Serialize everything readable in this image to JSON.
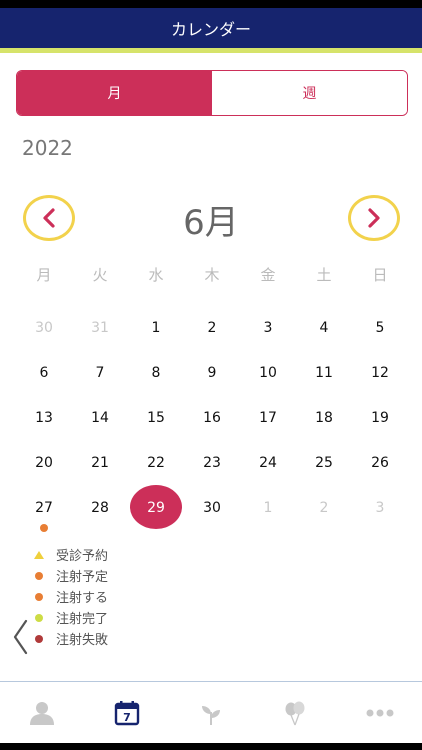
{
  "header": {
    "title": "カレンダー"
  },
  "view_toggle": {
    "month_label": "月",
    "week_label": "週"
  },
  "year": "2022",
  "month_label": "6月",
  "weekdays": [
    "月",
    "火",
    "水",
    "木",
    "金",
    "土",
    "日"
  ],
  "weeks": [
    [
      {
        "d": "30",
        "m": true
      },
      {
        "d": "31",
        "m": true
      },
      {
        "d": "1"
      },
      {
        "d": "2"
      },
      {
        "d": "3"
      },
      {
        "d": "4"
      },
      {
        "d": "5"
      }
    ],
    [
      {
        "d": "6"
      },
      {
        "d": "7"
      },
      {
        "d": "8"
      },
      {
        "d": "9"
      },
      {
        "d": "10"
      },
      {
        "d": "11"
      },
      {
        "d": "12"
      }
    ],
    [
      {
        "d": "13"
      },
      {
        "d": "14"
      },
      {
        "d": "15"
      },
      {
        "d": "16"
      },
      {
        "d": "17"
      },
      {
        "d": "18"
      },
      {
        "d": "19"
      }
    ],
    [
      {
        "d": "20"
      },
      {
        "d": "21"
      },
      {
        "d": "22"
      },
      {
        "d": "23"
      },
      {
        "d": "24"
      },
      {
        "d": "25"
      },
      {
        "d": "26"
      }
    ],
    [
      {
        "d": "27",
        "event": "#e87e34"
      },
      {
        "d": "28"
      },
      {
        "d": "29",
        "selected": true
      },
      {
        "d": "30"
      },
      {
        "d": "1",
        "m": true
      },
      {
        "d": "2",
        "m": true
      },
      {
        "d": "3",
        "m": true
      }
    ]
  ],
  "legend": [
    {
      "label": "受診予約",
      "shape": "triangle",
      "color": "#efd03c"
    },
    {
      "label": "注射予定",
      "shape": "dot",
      "color": "#e87e34"
    },
    {
      "label": "注射する",
      "shape": "dot",
      "color": "#e87e34"
    },
    {
      "label": "注射完了",
      "shape": "dot",
      "color": "#cddc45"
    },
    {
      "label": "注射失敗",
      "shape": "dot",
      "color": "#b03a3a"
    }
  ],
  "tabs": [
    {
      "icon": "user-icon",
      "active": false
    },
    {
      "icon": "calendar-icon",
      "date_text": "7",
      "active": true
    },
    {
      "icon": "plant-icon",
      "active": false
    },
    {
      "icon": "balloons-icon",
      "active": false
    },
    {
      "icon": "more-icon",
      "active": false
    }
  ],
  "colors": {
    "header_bg": "#16246e",
    "accent_line": "#d6e36a",
    "primary": "#cc2f59",
    "nav_ring": "#f2d24c",
    "tab_active": "#16246e",
    "tab_inactive": "#c8c8c8"
  }
}
